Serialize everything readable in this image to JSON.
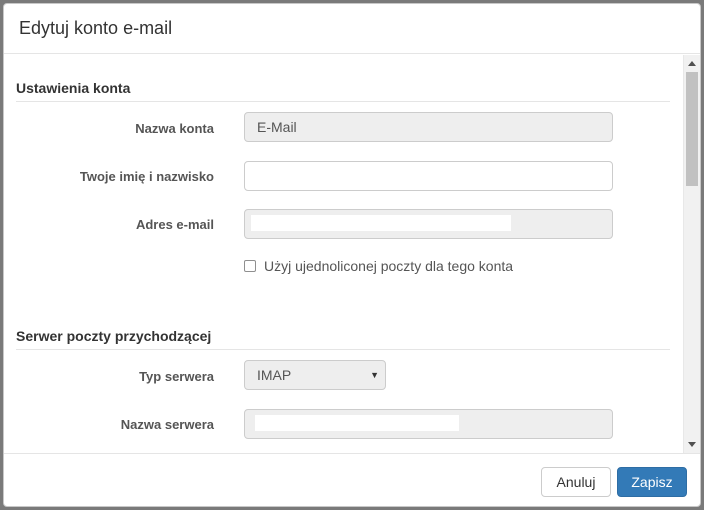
{
  "dialog": {
    "title": "Edytuj konto e-mail"
  },
  "account_settings": {
    "section_title": "Ustawienia konta",
    "account_name_label": "Nazwa konta",
    "account_name_value": "E-Mail",
    "full_name_label": "Twoje imię i nazwisko",
    "full_name_value": "",
    "email_label": "Adres e-mail",
    "unified_mail_label": "Użyj ujednoliconej poczty dla tego konta",
    "unified_mail_checked": false
  },
  "incoming_server": {
    "section_title": "Serwer poczty przychodzącej",
    "server_type_label": "Typ serwera",
    "server_type_value": "IMAP",
    "server_name_label": "Nazwa serwera"
  },
  "footer": {
    "cancel_label": "Anuluj",
    "save_label": "Zapisz"
  },
  "colors": {
    "primary": "#337ab7",
    "readonly_bg": "#eeeeee"
  },
  "icons": {
    "select_caret": "caret-down-icon",
    "checkbox": "checkbox-icon"
  }
}
